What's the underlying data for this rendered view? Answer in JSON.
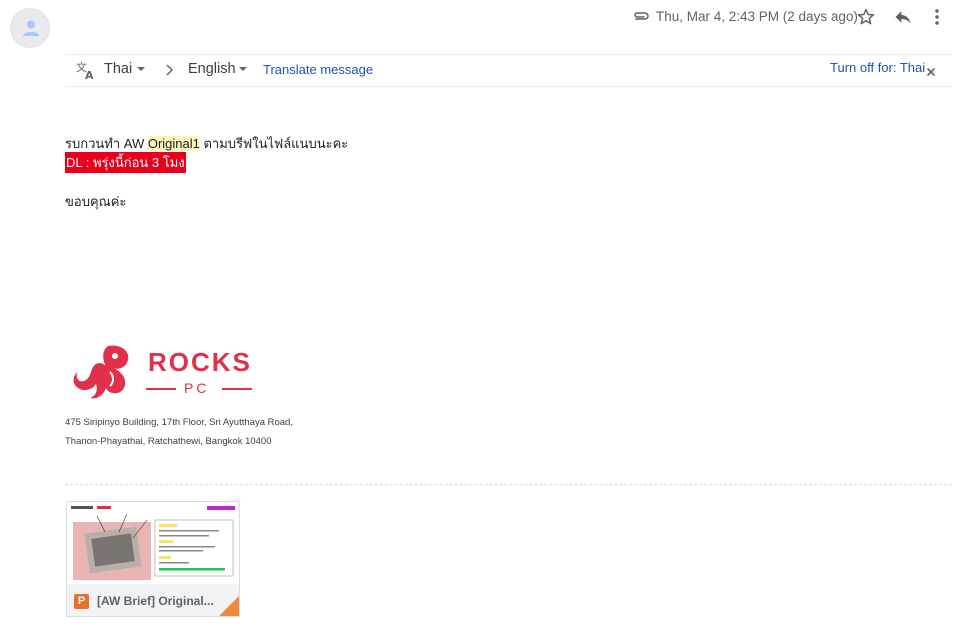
{
  "header": {
    "date": "Thu, Mar 4, 2:43 PM (2 days ago)"
  },
  "translate_bar": {
    "source_lang": "Thai",
    "target_lang": "English",
    "translate_link": "Translate message",
    "turn_off": "Turn off for: Thai"
  },
  "message": {
    "line1_prefix": "รบกวนทำ AW ",
    "line1_highlight": "Original1",
    "line1_suffix": " ตามบรีฟในไฟล์แนบนะคะ",
    "line2": "DL : พรุ่งนี้ก่อน 3 โมง",
    "line3": "ขอบคุณค่ะ"
  },
  "signature": {
    "logo_word": "ROCKS",
    "logo_sub": "PC",
    "address_line1": "475 Siripinyo Building, 17th Floor, Sri Ayutthaya Road,",
    "address_line2": "Thanon-Phayathai, Ratchathewi, Bangkok 10400"
  },
  "attachment": {
    "name": "[AW Brief] Original..."
  },
  "colors": {
    "link": "#1a56b5",
    "deadline_bg": "#e8001c",
    "highlight": "#fff5b8",
    "brand": "#e0304a"
  }
}
